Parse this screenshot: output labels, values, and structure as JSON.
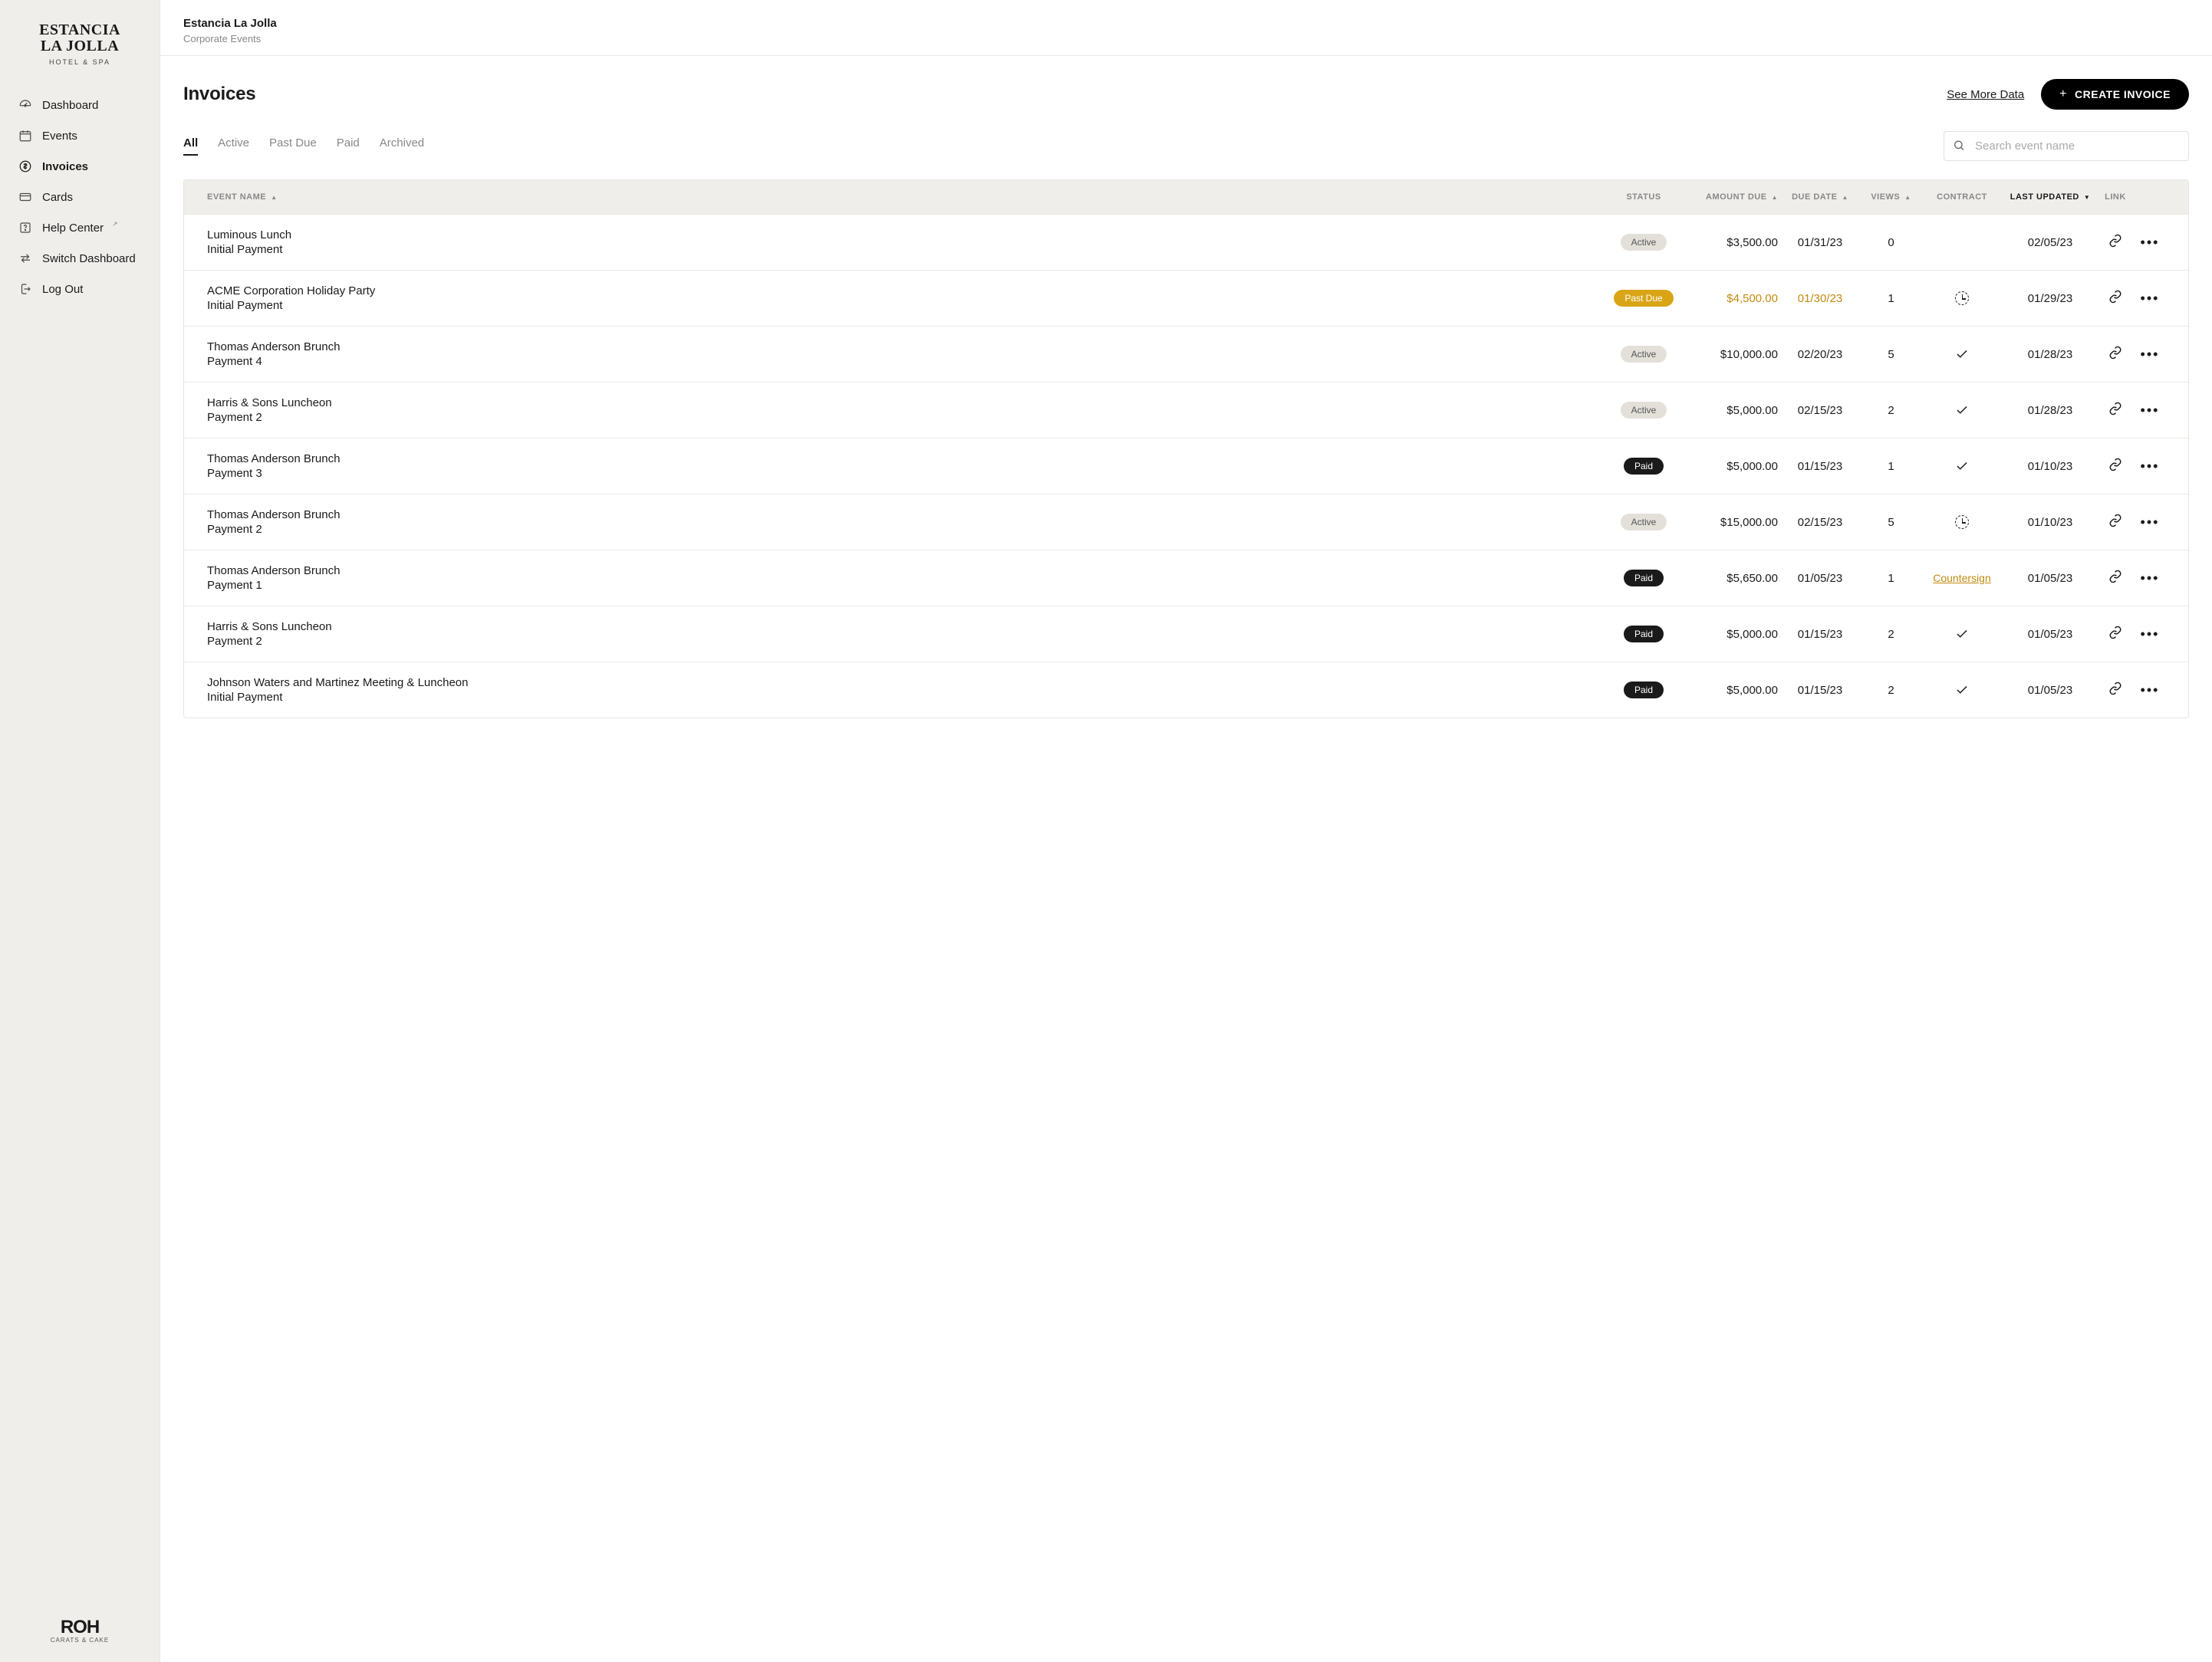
{
  "logo": {
    "line1": "ESTANCIA",
    "line2": "LA JOLLA",
    "line3": "HOTEL & SPA"
  },
  "footer_logo": {
    "name": "ROH",
    "sub": "CARATS & CAKE"
  },
  "nav": {
    "items": [
      {
        "label": "Dashboard",
        "icon": "dashboard"
      },
      {
        "label": "Events",
        "icon": "calendar"
      },
      {
        "label": "Invoices",
        "icon": "dollar",
        "active": true
      },
      {
        "label": "Cards",
        "icon": "card"
      },
      {
        "label": "Help Center",
        "icon": "help",
        "external": true
      },
      {
        "label": "Switch Dashboard",
        "icon": "switch"
      },
      {
        "label": "Log Out",
        "icon": "logout"
      }
    ]
  },
  "header": {
    "title": "Estancia La Jolla",
    "subtitle": "Corporate Events"
  },
  "page": {
    "title": "Invoices",
    "see_more": "See More Data",
    "create_btn": "CREATE INVOICE"
  },
  "tabs": [
    "All",
    "Active",
    "Past Due",
    "Paid",
    "Archived"
  ],
  "active_tab": "All",
  "search": {
    "placeholder": "Search event name"
  },
  "columns": {
    "event": "EVENT NAME",
    "status": "STATUS",
    "amount": "AMOUNT DUE",
    "due": "DUE DATE",
    "views": "VIEWS",
    "contract": "CONTRACT",
    "updated": "LAST UPDATED",
    "link": "LINK"
  },
  "status_labels": {
    "active": "Active",
    "pastdue": "Past Due",
    "paid": "Paid"
  },
  "contract_labels": {
    "countersign": "Countersign"
  },
  "rows": [
    {
      "event": "Luminous Lunch",
      "payment": "Initial Payment",
      "status": "active",
      "amount": "$3,500.00",
      "due": "01/31/23",
      "views": "0",
      "contract": "",
      "updated": "02/05/23"
    },
    {
      "event": "ACME Corporation Holiday Party",
      "payment": "Initial Payment",
      "status": "pastdue",
      "amount": "$4,500.00",
      "due": "01/30/23",
      "views": "1",
      "contract": "pending",
      "updated": "01/29/23",
      "highlight": true
    },
    {
      "event": "Thomas Anderson Brunch",
      "payment": "Payment 4",
      "status": "active",
      "amount": "$10,000.00",
      "due": "02/20/23",
      "views": "5",
      "contract": "accepted",
      "updated": "01/28/23"
    },
    {
      "event": "Harris & Sons Luncheon",
      "payment": "Payment 2",
      "status": "active",
      "amount": "$5,000.00",
      "due": "02/15/23",
      "views": "2",
      "contract": "accepted",
      "updated": "01/28/23"
    },
    {
      "event": "Thomas Anderson Brunch",
      "payment": "Payment 3",
      "status": "paid",
      "amount": "$5,000.00",
      "due": "01/15/23",
      "views": "1",
      "contract": "accepted",
      "updated": "01/10/23"
    },
    {
      "event": "Thomas Anderson Brunch",
      "payment": "Payment 2",
      "status": "active",
      "amount": "$15,000.00",
      "due": "02/15/23",
      "views": "5",
      "contract": "pending",
      "updated": "01/10/23"
    },
    {
      "event": "Thomas Anderson Brunch",
      "payment": "Payment 1",
      "status": "paid",
      "amount": "$5,650.00",
      "due": "01/05/23",
      "views": "1",
      "contract": "countersign",
      "updated": "01/05/23"
    },
    {
      "event": "Harris & Sons Luncheon",
      "payment": "Payment 2",
      "status": "paid",
      "amount": "$5,000.00",
      "due": "01/15/23",
      "views": "2",
      "contract": "accepted",
      "updated": "01/05/23"
    },
    {
      "event": "Johnson Waters and Martinez Meeting & Luncheon",
      "payment": "Initial Payment",
      "status": "paid",
      "amount": "$5,000.00",
      "due": "01/15/23",
      "views": "2",
      "contract": "accepted",
      "updated": "01/05/23"
    }
  ]
}
